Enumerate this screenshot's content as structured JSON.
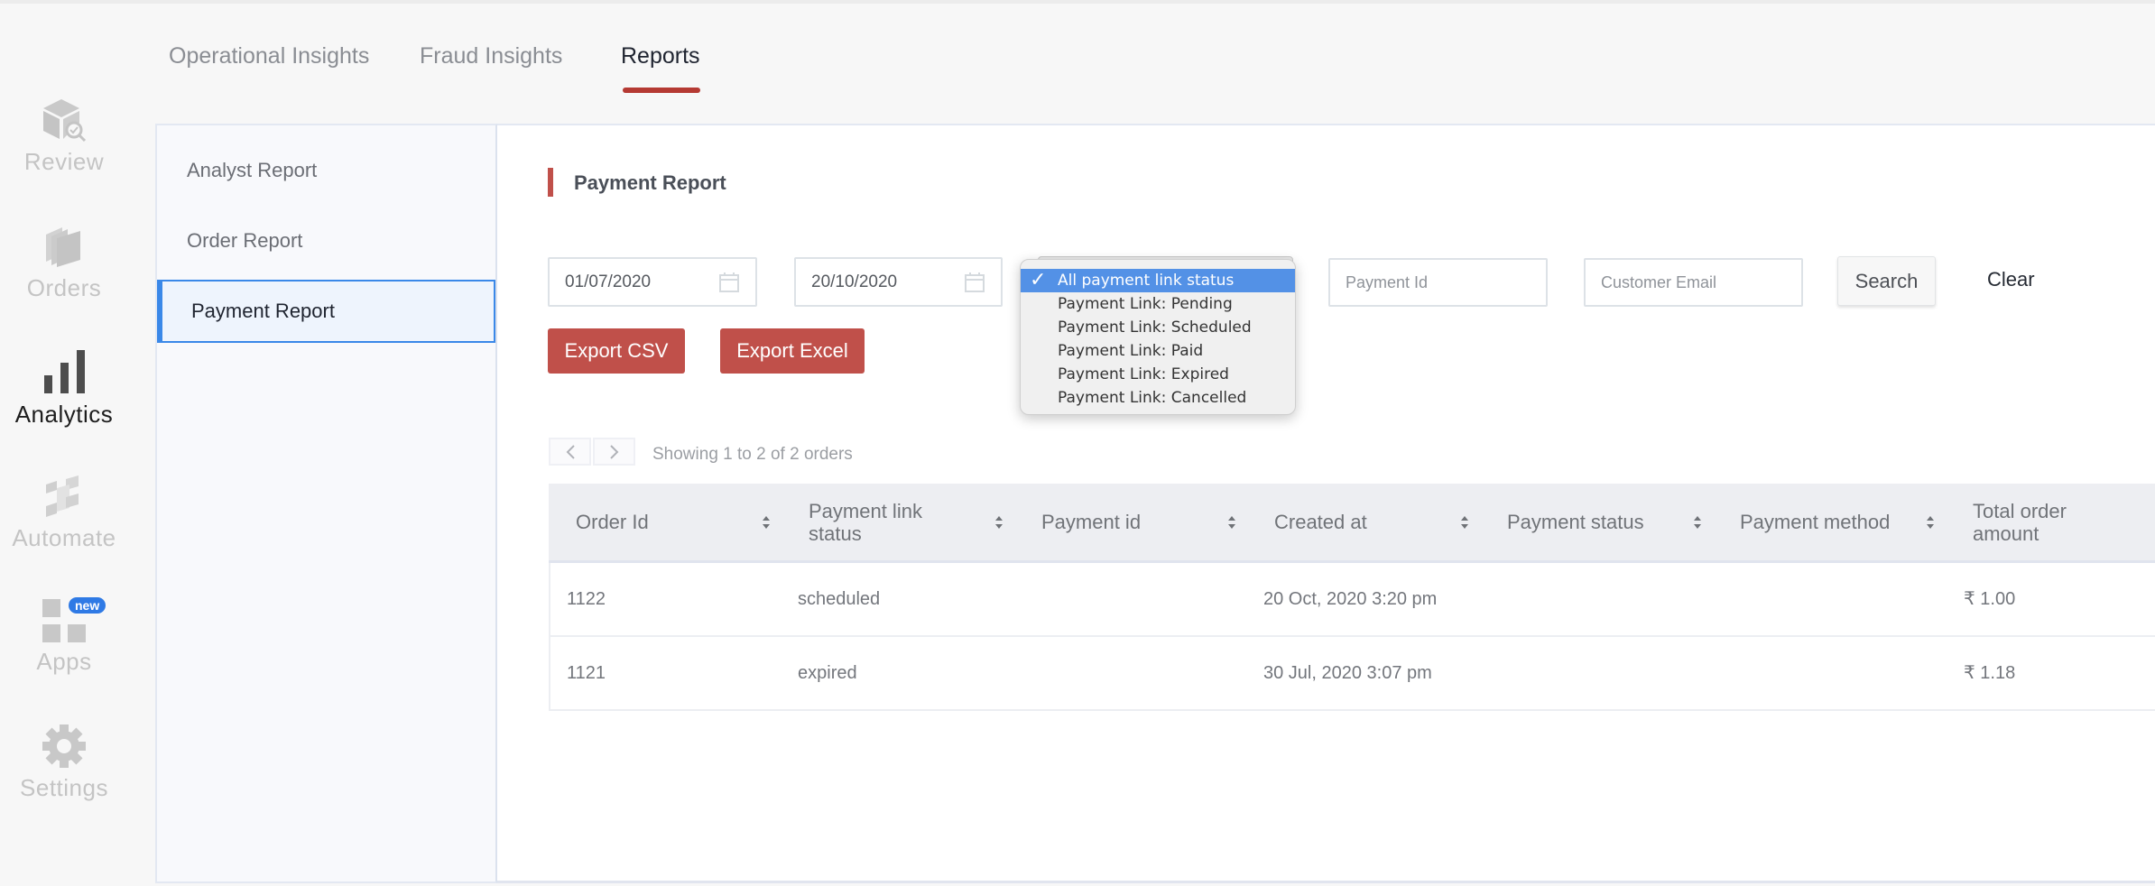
{
  "top_tabs": [
    {
      "label": "Operational Insights",
      "active": false
    },
    {
      "label": "Fraud Insights",
      "active": false
    },
    {
      "label": "Reports",
      "active": true
    }
  ],
  "rail": {
    "items": [
      {
        "label": "Review",
        "icon": "package-review-icon"
      },
      {
        "label": "Orders",
        "icon": "orders-stack-icon"
      },
      {
        "label": "Analytics",
        "icon": "bar-chart-icon",
        "active": true
      },
      {
        "label": "Automate",
        "icon": "automate-blocks-icon"
      },
      {
        "label": "Apps",
        "icon": "apps-grid-icon",
        "badge": "new"
      },
      {
        "label": "Settings",
        "icon": "gear-icon"
      }
    ]
  },
  "subnav": {
    "items": [
      {
        "label": "Analyst Report",
        "active": false
      },
      {
        "label": "Order Report",
        "active": false
      },
      {
        "label": "Payment Report",
        "active": true
      }
    ]
  },
  "report": {
    "title": "Payment Report",
    "filters": {
      "start_date": "01/07/2020",
      "end_date": "20/10/2020",
      "payment_id_placeholder": "Payment Id",
      "customer_email_placeholder": "Customer Email",
      "status_dropdown": {
        "selected": "All payment link status",
        "options": [
          "All payment link status",
          "Payment Link: Pending",
          "Payment Link: Scheduled",
          "Payment Link: Paid",
          "Payment Link: Expired",
          "Payment Link: Cancelled"
        ]
      }
    },
    "buttons": {
      "search": "Search",
      "clear": "Clear",
      "export_csv": "Export CSV",
      "export_excel": "Export Excel"
    },
    "pager_text": "Showing 1 to 2 of 2 orders",
    "table": {
      "columns": [
        "Order Id",
        "Payment link status",
        "Payment id",
        "Created at",
        "Payment status",
        "Payment method",
        "Total order amount"
      ],
      "rows": [
        {
          "order_id": "1122",
          "link_status": "scheduled",
          "payment_id": "",
          "created_at": "20 Oct, 2020 3:20 pm",
          "payment_status": "",
          "payment_method": "",
          "total": "₹ 1.00"
        },
        {
          "order_id": "1121",
          "link_status": "expired",
          "payment_id": "",
          "created_at": "30 Jul, 2020 3:07 pm",
          "payment_status": "",
          "payment_method": "",
          "total": "₹ 1.18"
        }
      ]
    }
  },
  "colors": {
    "accent_red": "#c0504a",
    "tab_underline": "#b53a33",
    "selection_blue": "#3a88e8",
    "dropdown_highlight": "#5391e6",
    "badge_blue": "#2f7ae5"
  }
}
